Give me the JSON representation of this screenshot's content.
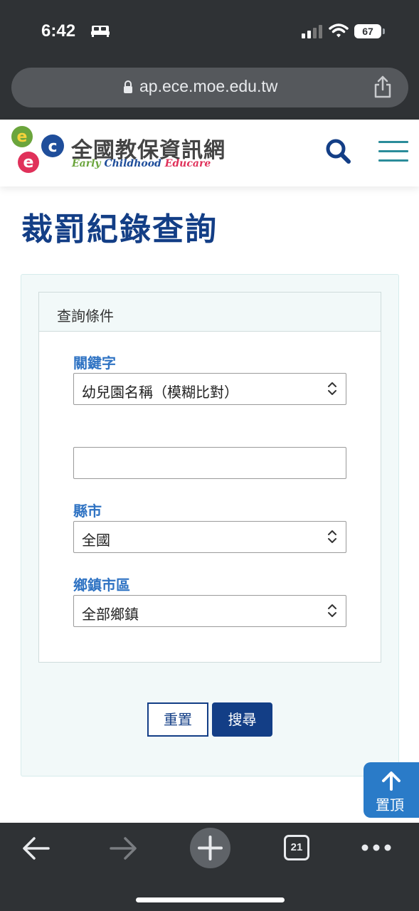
{
  "status_bar": {
    "time": "6:42",
    "battery": "67",
    "icons": [
      "bed-icon",
      "signal-icon",
      "wifi-icon",
      "battery-icon"
    ]
  },
  "browser": {
    "url": "ap.ece.moe.edu.tw",
    "tab_count": "21",
    "icons": [
      "lock-icon",
      "share-icon",
      "back-arrow-icon",
      "forward-arrow-icon",
      "plus-icon",
      "tabs-icon",
      "more-icon"
    ]
  },
  "site_header": {
    "brand_cn": "全國教保資訊網",
    "brand_en_1": "Early",
    "brand_en_2": "Childhood",
    "brand_en_3": "Educare"
  },
  "page": {
    "title": "裁罰紀錄查詢"
  },
  "form": {
    "legend": "查詢條件",
    "keyword_label": "關鍵字",
    "keyword_type_value": "幼兒園名稱（模糊比對）",
    "keyword_input_value": "",
    "county_label": "縣市",
    "county_value": "全國",
    "township_label": "鄉鎮市區",
    "township_value": "全部鄉鎮",
    "reset_label": "重置",
    "search_label": "搜尋"
  },
  "back_to_top": {
    "label": "置頂"
  },
  "colors": {
    "brand_navy": "#133e86",
    "label_blue": "#2f73c3",
    "panel_bg": "#f2f9f9",
    "chrome_dark": "#2f3235"
  }
}
